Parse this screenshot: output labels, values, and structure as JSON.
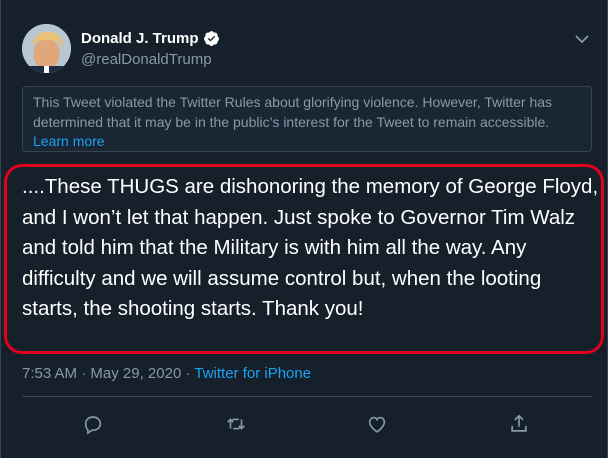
{
  "user": {
    "display_name": "Donald J. Trump",
    "handle": "@realDonaldTrump",
    "verified": true
  },
  "notice": {
    "text": "This Tweet violated the Twitter Rules about glorifying violence. However, Twitter has determined that it may be in the public’s interest for the Tweet to remain accessible.",
    "link_text": "Learn more"
  },
  "tweet": {
    "text": "....These THUGS are dishonoring the memory of George Floyd, and I won’t let that happen. Just spoke to Governor Tim Walz and told him that the Military is with him all the way. Any difficulty and we will assume control but, when the looting starts, the shooting starts. Thank you!",
    "time": "7:53 AM",
    "sep1": " · ",
    "date": "May 29, 2020",
    "sep2": " · ",
    "source": "Twitter for iPhone"
  },
  "icons": {
    "more": "chevron-down-icon",
    "reply": "reply-icon",
    "retweet": "retweet-icon",
    "like": "heart-icon",
    "share": "share-icon"
  },
  "colors": {
    "background": "#15202b",
    "accent": "#1da1f2",
    "highlight": "#e0001b",
    "muted": "#8899a6"
  }
}
